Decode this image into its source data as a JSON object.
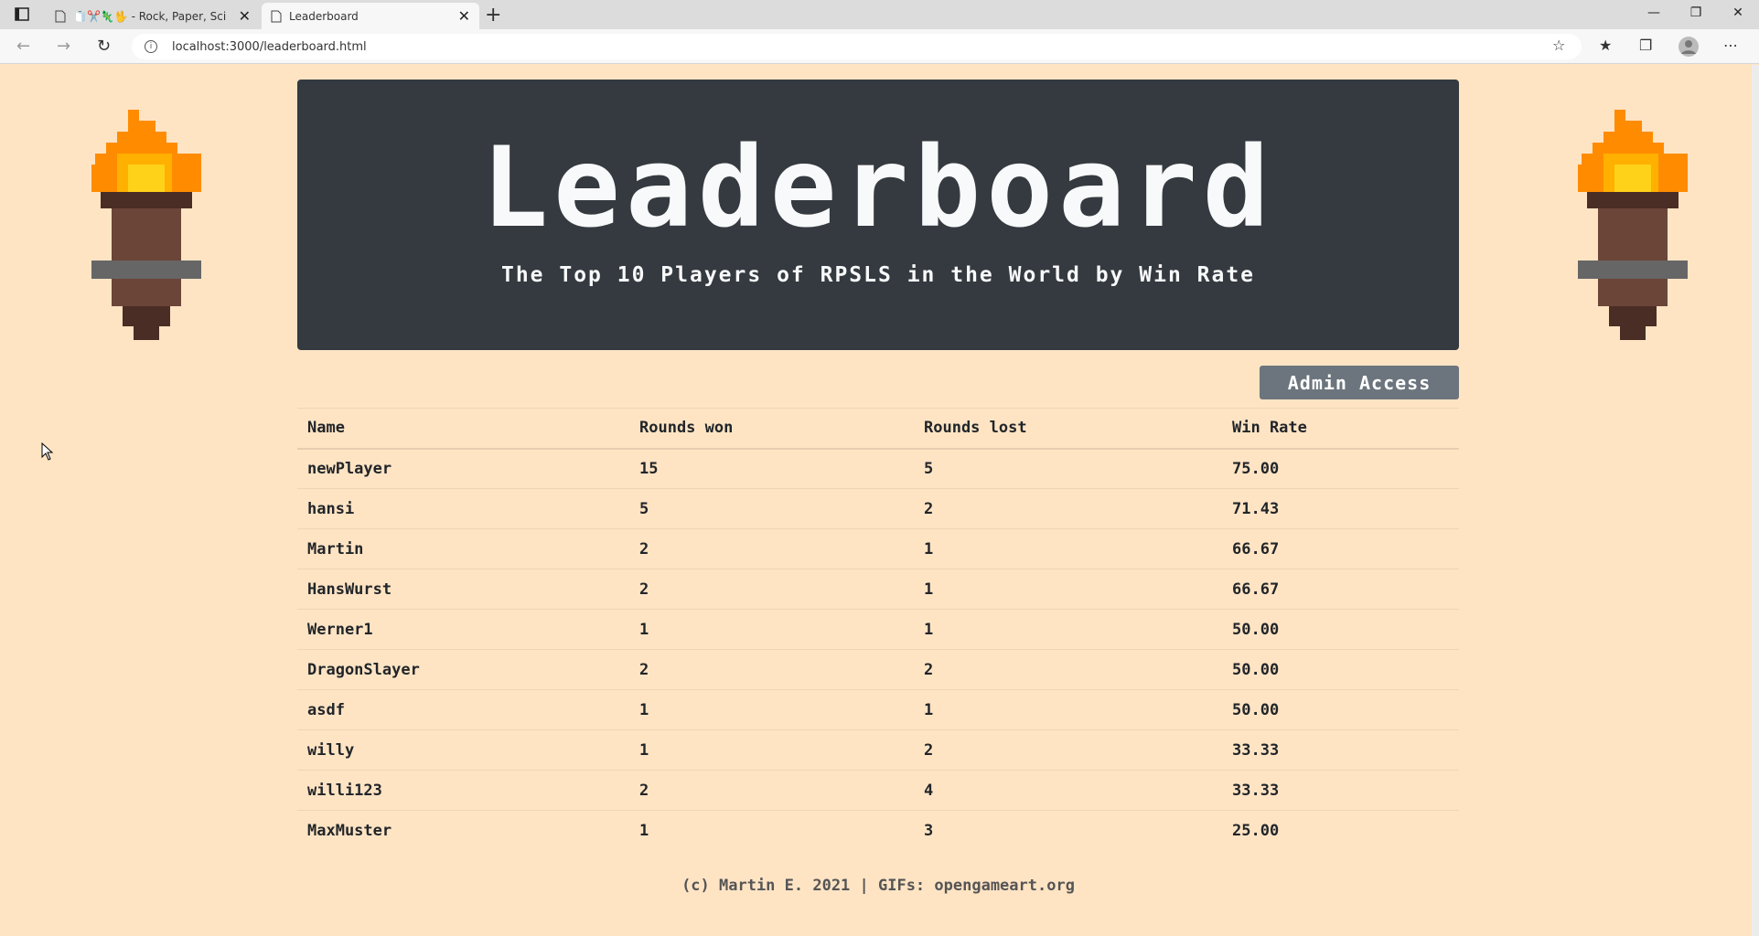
{
  "browser": {
    "tabs": [
      {
        "title": "🧻✂️🦎🖖 - Rock, Paper, Sci",
        "close": "✕"
      },
      {
        "title": "Leaderboard",
        "close": "✕"
      }
    ],
    "new_tab": "+",
    "url": "localhost:3000/leaderboard.html",
    "window_controls": [
      "—",
      "❐",
      "✕"
    ]
  },
  "header": {
    "title": "Leaderboard",
    "subtitle": "The Top 10 Players of RPSLS in the World by Win Rate"
  },
  "admin_button": "Admin Access",
  "table": {
    "columns": [
      "Name",
      "Rounds won",
      "Rounds lost",
      "Win Rate"
    ],
    "rows": [
      {
        "name": "newPlayer",
        "won": "15",
        "lost": "5",
        "rate": "75.00"
      },
      {
        "name": "hansi",
        "won": "5",
        "lost": "2",
        "rate": "71.43"
      },
      {
        "name": "Martin",
        "won": "2",
        "lost": "1",
        "rate": "66.67"
      },
      {
        "name": "HansWurst",
        "won": "2",
        "lost": "1",
        "rate": "66.67"
      },
      {
        "name": "Werner1",
        "won": "1",
        "lost": "1",
        "rate": "50.00"
      },
      {
        "name": "DragonSlayer",
        "won": "2",
        "lost": "2",
        "rate": "50.00"
      },
      {
        "name": "asdf",
        "won": "1",
        "lost": "1",
        "rate": "50.00"
      },
      {
        "name": "willy",
        "won": "1",
        "lost": "2",
        "rate": "33.33"
      },
      {
        "name": "willi123",
        "won": "2",
        "lost": "4",
        "rate": "33.33"
      },
      {
        "name": "MaxMuster",
        "won": "1",
        "lost": "3",
        "rate": "25.00"
      }
    ]
  },
  "footer": "(c) Martin E. 2021 | GIFs: opengameart.org",
  "colors": {
    "page_bg": "#ffe4c4",
    "header_bg": "#343a40",
    "button_bg": "#6c757d"
  }
}
